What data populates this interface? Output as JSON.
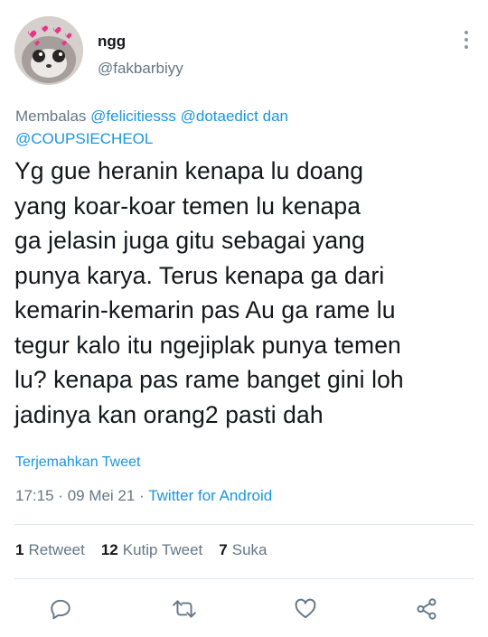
{
  "user": {
    "name": "ngg",
    "handle": "@fakbarbiyy"
  },
  "replying": {
    "prefix": "Membalas",
    "mentions": [
      "@felicitiesss",
      "@dotaedict"
    ],
    "conjunction": "dan",
    "last_mention": "@COUPSIECHEOL"
  },
  "tweet": {
    "text": "Yg gue heranin kenapa lu doang\nyang koar-koar temen lu kenapa\nga jelasin juga gitu sebagai yang\npunya karya. Terus kenapa ga dari\nkemarin-kemarin pas Au ga rame lu\ntegur kalo itu ngejiplak punya temen\nlu? kenapa pas rame banget gini loh\njadinya kan orang2 pasti dah",
    "translate_label": "Terjemahkan Tweet"
  },
  "meta": {
    "time": "17:15",
    "date": "09 Mei 21",
    "separator": "·",
    "source": "Twitter for Android"
  },
  "stats": {
    "retweets_count": "1",
    "retweets_label": "Retweet",
    "quotes_count": "12",
    "quotes_label": "Kutip Tweet",
    "likes_count": "7",
    "likes_label": "Suka"
  },
  "icons": {
    "reply": "reply-icon",
    "retweet": "retweet-icon",
    "like": "heart-icon",
    "share": "share-icon",
    "more": "more-vertical-icon"
  },
  "colors": {
    "link": "#1b95e0",
    "secondary_text": "#657786",
    "primary_text": "#14171a",
    "divider": "#e1e8ed"
  }
}
